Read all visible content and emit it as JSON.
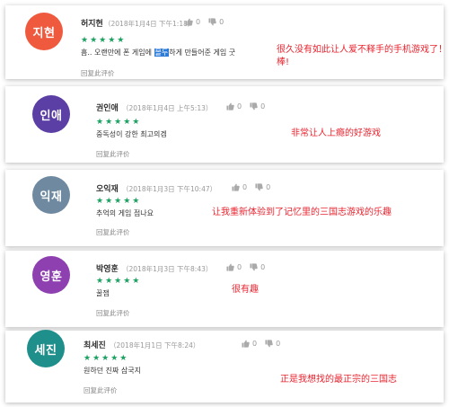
{
  "reviews": [
    {
      "avatar_text": "지현",
      "avatar_color": "#ef5a3f",
      "name": "허지현",
      "date": "（2018年1月4日 下午1:18）",
      "likes": "0",
      "dislikes": "0",
      "rating": "★★★★★",
      "text_before": "흠.. 오랜만에 폰 게임에 ",
      "text_highlight": "몰두",
      "text_after": "하게 만들어준 게임 굿",
      "reply_label": "回复此评价",
      "annotation_line1": "很久没有如此让人爱不释手的手机游戏了！",
      "annotation_line2": "棒!"
    },
    {
      "avatar_text": "인애",
      "avatar_color": "#5b3fa5",
      "name": "권인애",
      "date": "（2018年1月4日 上午5:13）",
      "likes": "0",
      "dislikes": "0",
      "rating": "★★★★★",
      "text": "중독성이 강한 최고의겜",
      "reply_label": "回复此评价",
      "annotation": "非常让人上瘾的好游戏"
    },
    {
      "avatar_text": "익재",
      "avatar_color": "#6f8aa0",
      "name": "오익재",
      "date": "（2018年1月3日 下午10:47）",
      "likes": "0",
      "dislikes": "0",
      "rating": "★★★★★",
      "text": "추억의 게임 점나요",
      "reply_label": "回复此评价",
      "annotation": "让我重新体验到了记忆里的三国志游戏的乐趣"
    },
    {
      "avatar_text": "영훈",
      "avatar_color": "#8e3fb0",
      "name": "박영훈",
      "date": "（2018年1月3日 下午8:43）",
      "likes": "0",
      "dislikes": "0",
      "rating": "★★★★★",
      "text": "꿀잼",
      "reply_label": "回复此评价",
      "annotation": "很有趣"
    },
    {
      "avatar_text": "세진",
      "avatar_color": "#1f8f8c",
      "name": "최세진",
      "date": "（2018年1月1日 下午8:24）",
      "likes": "0",
      "dislikes": "0",
      "rating": "★★★★★",
      "text": "원하던 진짜 삼국지",
      "reply_label": "回复此评价",
      "annotation": "正是我想找的最正宗的三国志"
    }
  ]
}
